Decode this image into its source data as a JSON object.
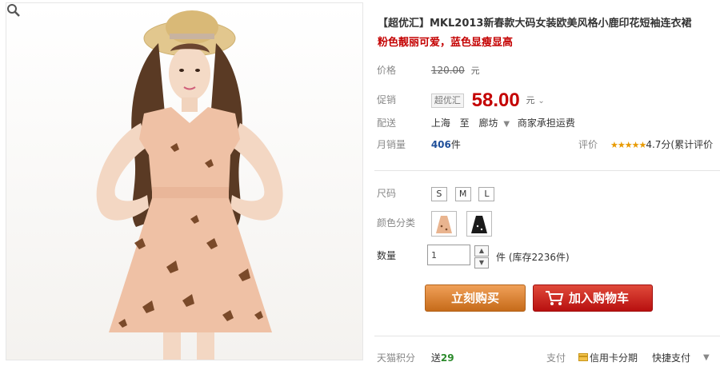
{
  "product": {
    "title": "【超优汇】MKL2013新春款大码女装欧美风格小鹿印花短袖连衣裙",
    "subtitle": "粉色靓丽可爱，蓝色显瘦显高"
  },
  "price": {
    "label": "价格",
    "original": "120.00",
    "unit": "元"
  },
  "promo": {
    "label": "促销",
    "badge": "超优汇",
    "price": "58.00",
    "unit": "元"
  },
  "shipping": {
    "label": "配送",
    "from": "上海",
    "to_word": "至",
    "destination": "廊坊",
    "note": "商家承担运费"
  },
  "sales": {
    "label": "月销量",
    "count": "406",
    "unit": "件",
    "rating_label": "评价",
    "stars": "★★★★★",
    "score": "4.7分",
    "reviews": "(累计评价"
  },
  "size": {
    "label": "尺码",
    "options": [
      "S",
      "M",
      "L"
    ]
  },
  "color": {
    "label": "颜色分类"
  },
  "quantity": {
    "label": "数量",
    "value": "1",
    "stock": "件 (库存2236件)"
  },
  "actions": {
    "buy": "立刻购买",
    "cart": "加入购物车"
  },
  "footer": {
    "points_label": "天猫积分",
    "points_prefix": "送",
    "points_value": "29",
    "pay_label": "支付",
    "credit": "信用卡分期",
    "quickpay": "快捷支付"
  },
  "colors": {
    "price_red": "#c40000",
    "buy_orange": "#d97b2a",
    "cart_red": "#c8201a",
    "sales_blue": "#1f4f9a"
  }
}
